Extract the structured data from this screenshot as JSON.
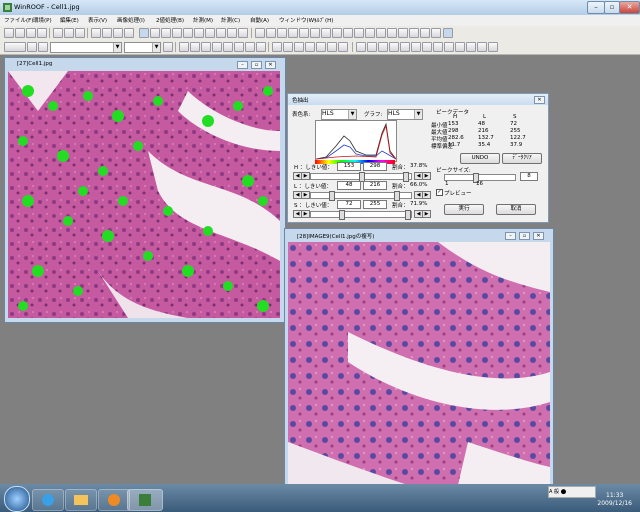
{
  "app": {
    "title": "WinROOF - Cell1.jpg",
    "icon": "winroof-icon"
  },
  "menu": [
    "ファイル(F)",
    "環境(P)",
    "編集(E)",
    "表示(V)",
    "画像処理(I)",
    "2値処理(B)",
    "計測(M)",
    "計測(C)",
    "自動(A)",
    "ウィンドウ(W)",
    "ﾍﾙﾌﾟ(H)"
  ],
  "toolbar2": {
    "combo1_value": "",
    "combo2_value": ""
  },
  "window1": {
    "title": "[27]Cell1.jpg"
  },
  "window2": {
    "title": "[28]IMAGE9(Cell1.jpgの複写)"
  },
  "dialog": {
    "title": "色抽出",
    "color_system_label": "表色系:",
    "color_system_value": "HLS",
    "graph_label": "グラフ:",
    "graph_value": "HLS",
    "peak_data_label": "ピークデータ",
    "table_headers": [
      "",
      "H",
      "L",
      "S"
    ],
    "table_rows": [
      [
        "最小値",
        "153",
        "48",
        "72"
      ],
      [
        "最大値",
        "298",
        "216",
        "255"
      ],
      [
        "平均値",
        "282.6",
        "132.7",
        "122.7"
      ],
      [
        "標準偏差",
        "11.7",
        "35.4",
        "37.9"
      ]
    ],
    "undo_label": "UNDO",
    "data_clear_label": "ﾃﾞｰﾀｸﾘｱ",
    "peak_size_label": "ピークサイズ:",
    "peak_size_value": "8",
    "peak_slider_min": "1",
    "peak_slider_max": "16",
    "preview_label": "プレビュー",
    "h_label": "H ：しきい値：",
    "h_min": "153",
    "h_max": "298",
    "h_ratio_label": "割合：",
    "h_ratio": "37.8%",
    "l_label": "L ：しきい値：",
    "l_min": "48",
    "l_max": "216",
    "l_ratio_label": "割合：",
    "l_ratio": "66.0%",
    "s_label": "S ：しきい値：",
    "s_min": "72",
    "s_max": "255",
    "s_ratio_label": "割合：",
    "s_ratio": "71.9%",
    "run_label": "実行",
    "cancel_label": "取消"
  },
  "taskbar": {
    "time": "11:33",
    "date": "2009/12/16",
    "ime": "A 般 ⬤"
  }
}
